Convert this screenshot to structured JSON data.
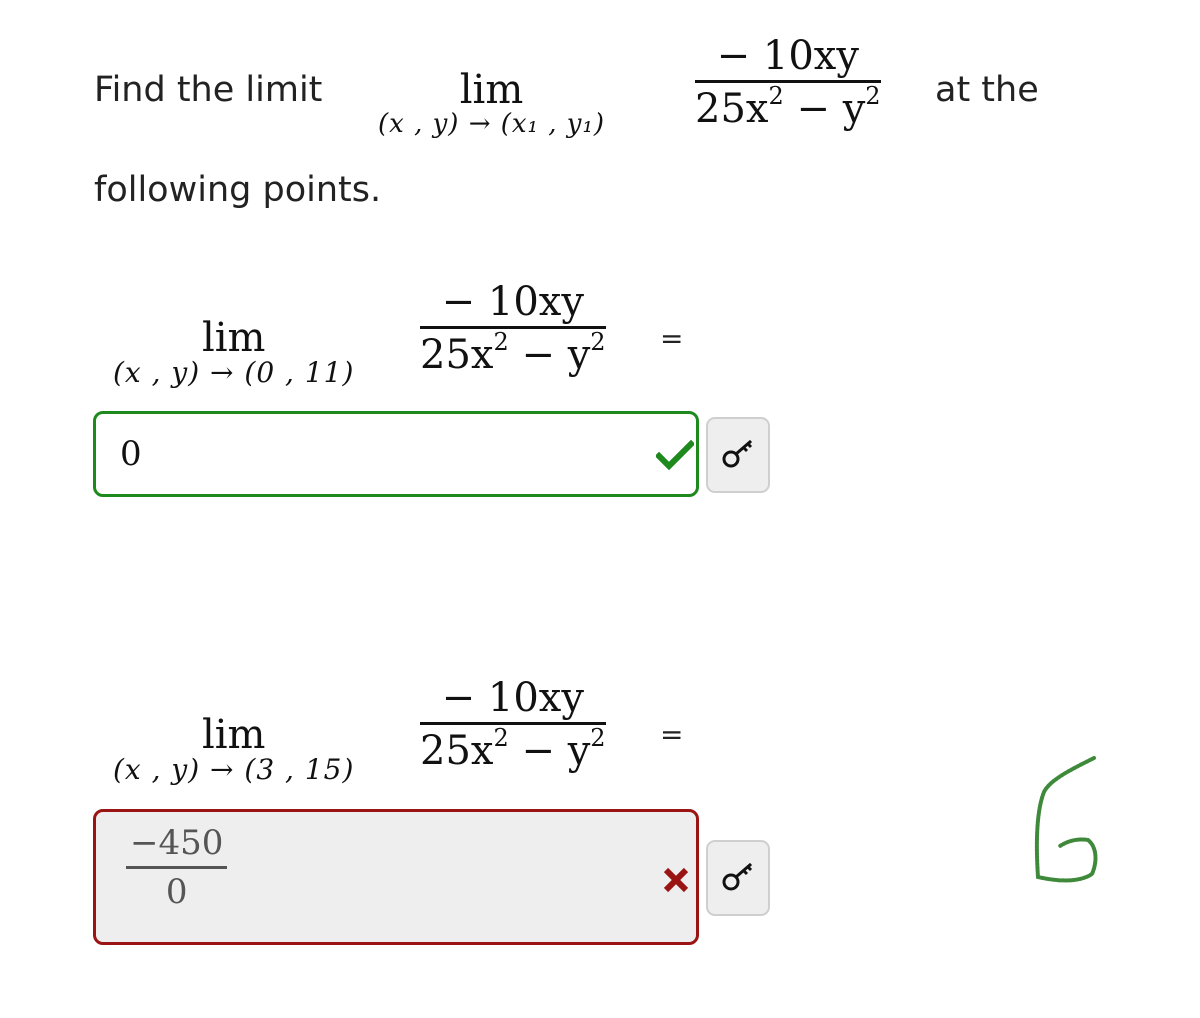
{
  "question": {
    "prefix": "Find the limit",
    "suffix": "at the",
    "line2": "following points.",
    "lim_word": "lim",
    "lim_sub_general": "(x , y) → (x₁ , y₁)",
    "numerator": "− 10xy",
    "denominator_a": "25x",
    "denominator_exp1": "2",
    "denominator_mid": " − y",
    "denominator_exp2": "2"
  },
  "parts": [
    {
      "lim_word": "lim",
      "point": "(x , y) → (0 , 11)",
      "numerator": "− 10xy",
      "denominator_a": "25x",
      "denominator_exp1": "2",
      "denominator_mid": " − y",
      "denominator_exp2": "2",
      "equals": "=",
      "answer": "0",
      "status": "correct",
      "status_icon": "checkmark-icon",
      "status_color": "#1e8a1e",
      "key_icon": "key-icon"
    },
    {
      "lim_word": "lim",
      "point": "(x , y) → (3 , 15)",
      "numerator": "− 10xy",
      "denominator_a": "25x",
      "denominator_exp1": "2",
      "denominator_mid": " − y",
      "denominator_exp2": "2",
      "equals": "=",
      "answer_numerator": "−450",
      "answer_denominator": "0",
      "status": "incorrect",
      "status_icon": "cross-icon",
      "status_color": "#9b1414",
      "key_icon": "key-icon"
    }
  ],
  "annotation": {
    "handwritten_text": "6",
    "color": "#3f8a3a"
  }
}
